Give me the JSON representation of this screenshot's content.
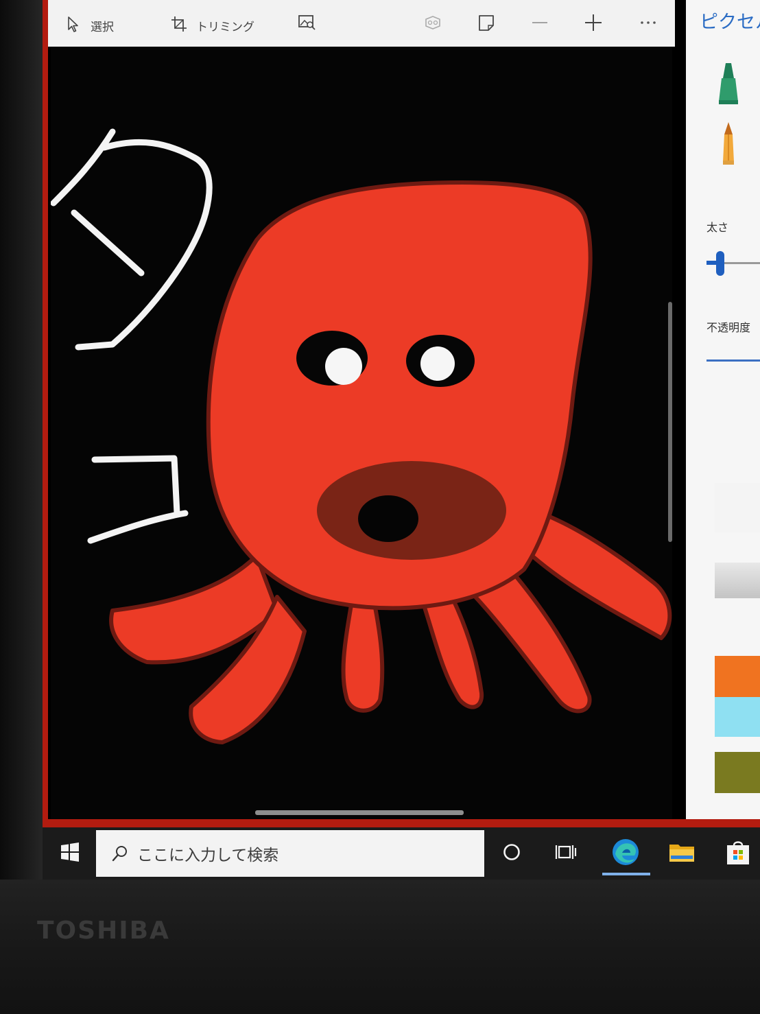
{
  "toolbar": {
    "select_label": "選択",
    "crop_label": "トリミング"
  },
  "panel": {
    "title": "ピクセル",
    "thickness_label": "太さ",
    "opacity_label": "不透明度",
    "thickness_level": 0.25,
    "swatches": [
      "#f07320",
      "#8fe0f2",
      "#7a7a20"
    ]
  },
  "canvas": {
    "background_color": "#050505",
    "octopus_color": "#ec3b26",
    "handwritten_text": "タコ"
  },
  "taskbar": {
    "search_placeholder": "ここに入力して検索"
  },
  "monitor": {
    "brand": "TOSHIBA"
  },
  "icons": [
    "cursor-icon",
    "crop-icon",
    "image-search-icon",
    "mixed-reality-icon",
    "sticker-icon",
    "zoom-out-icon",
    "zoom-in-icon",
    "more-icon",
    "marker-icon",
    "pencil-icon",
    "windows-start-icon",
    "search-icon",
    "cortana-icon",
    "task-view-icon",
    "edge-icon",
    "file-explorer-icon",
    "store-icon"
  ]
}
